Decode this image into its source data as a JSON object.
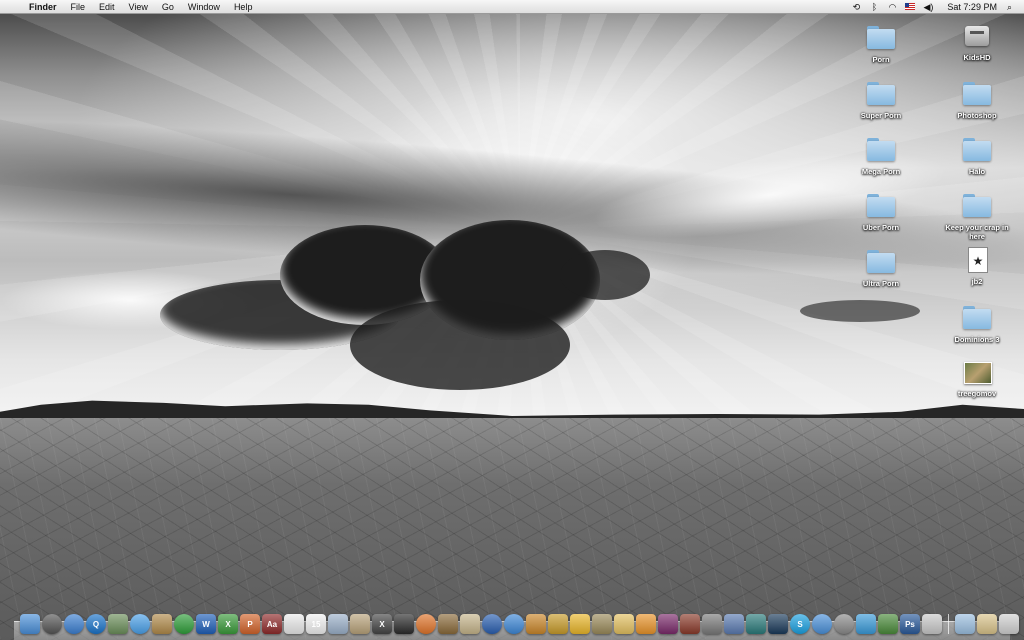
{
  "menubar": {
    "apple_icon": "apple-icon",
    "items": [
      "Finder",
      "File",
      "Edit",
      "View",
      "Go",
      "Window",
      "Help"
    ],
    "status_icons": [
      "time-machine-icon",
      "bluetooth-icon",
      "wifi-icon",
      "input-flag-icon",
      "volume-icon"
    ],
    "clock": "Sat 7:29 PM",
    "spotlight_icon": "spotlight-icon"
  },
  "desktop_icons": [
    {
      "label": "Porn",
      "type": "folder"
    },
    {
      "label": "KidsHD",
      "type": "drive"
    },
    {
      "label": "Super Porn",
      "type": "folder"
    },
    {
      "label": "Photoshop",
      "type": "folder"
    },
    {
      "label": "Mega Porn",
      "type": "folder"
    },
    {
      "label": "Halo",
      "type": "folder"
    },
    {
      "label": "Uber Porn",
      "type": "folder"
    },
    {
      "label": "Keep your crap in here",
      "type": "folder"
    },
    {
      "label": "Ultra Porn",
      "type": "folder"
    },
    {
      "label": "jb2",
      "type": "movie-doc"
    },
    {
      "label": "Dominions 3",
      "type": "folder"
    },
    {
      "label": "treegomov",
      "type": "thumb"
    }
  ],
  "dock": {
    "items": [
      {
        "icon": "finder-icon",
        "color": "#4a8fd8",
        "glyph": ""
      },
      {
        "icon": "dashboard-icon",
        "color": "#555555",
        "glyph": ""
      },
      {
        "icon": "safari-icon",
        "color": "#3b7fd1",
        "glyph": ""
      },
      {
        "icon": "quicktime-icon",
        "color": "#1a73c9",
        "glyph": "Q"
      },
      {
        "icon": "utility-icon",
        "color": "#6b8e5a",
        "glyph": ""
      },
      {
        "icon": "ichat-icon",
        "color": "#4aa0e8",
        "glyph": ""
      },
      {
        "icon": "address-book-icon",
        "color": "#b08a4a",
        "glyph": ""
      },
      {
        "icon": "green-app-icon",
        "color": "#2f9e3a",
        "glyph": ""
      },
      {
        "icon": "word-icon",
        "color": "#1f5fb8",
        "glyph": "W"
      },
      {
        "icon": "excel-icon",
        "color": "#3a9a3a",
        "glyph": "X"
      },
      {
        "icon": "powerpoint-icon",
        "color": "#d2632a",
        "glyph": "P"
      },
      {
        "icon": "dictionary-icon",
        "color": "#8e2a2a",
        "glyph": "Aa"
      },
      {
        "icon": "textedit-icon",
        "color": "#e9e9e9",
        "glyph": ""
      },
      {
        "icon": "ical-icon",
        "color": "#f0f0f0",
        "glyph": "15"
      },
      {
        "icon": "preview-icon",
        "color": "#9bb0c9",
        "glyph": ""
      },
      {
        "icon": "mail-icon",
        "color": "#b8a27a",
        "glyph": ""
      },
      {
        "icon": "x11-icon",
        "color": "#444444",
        "glyph": "X"
      },
      {
        "icon": "clapper-icon",
        "color": "#2b2b2b",
        "glyph": ""
      },
      {
        "icon": "firefox-icon",
        "color": "#e0742a",
        "glyph": ""
      },
      {
        "icon": "photo-icon",
        "color": "#8a6a3a",
        "glyph": ""
      },
      {
        "icon": "automator-icon",
        "color": "#c5b48a",
        "glyph": ""
      },
      {
        "icon": "network-icon",
        "color": "#2a5fb0",
        "glyph": ""
      },
      {
        "icon": "itunes-icon",
        "color": "#3d87d6",
        "glyph": ""
      },
      {
        "icon": "garageband-icon",
        "color": "#c9862a",
        "glyph": ""
      },
      {
        "icon": "feather-icon",
        "color": "#c79b2a",
        "glyph": ""
      },
      {
        "icon": "iphoto-icon",
        "color": "#e9b62a",
        "glyph": ""
      },
      {
        "icon": "city-icon",
        "color": "#9a8a5a",
        "glyph": ""
      },
      {
        "icon": "pizza-icon",
        "color": "#e3c060",
        "glyph": ""
      },
      {
        "icon": "orange-app-icon",
        "color": "#e8932a",
        "glyph": ""
      },
      {
        "icon": "game-icon",
        "color": "#7a2a6a",
        "glyph": ""
      },
      {
        "icon": "tea-icon",
        "color": "#8a3a2a",
        "glyph": ""
      },
      {
        "icon": "pen-icon",
        "color": "#7a7a7a",
        "glyph": ""
      },
      {
        "icon": "app-store-icon",
        "color": "#5a7ab0",
        "glyph": ""
      },
      {
        "icon": "terminal-icon",
        "color": "#2a7a7a",
        "glyph": ""
      },
      {
        "icon": "activity-icon",
        "color": "#1a3a5a",
        "glyph": ""
      },
      {
        "icon": "skype-icon",
        "color": "#1aa0e0",
        "glyph": "S"
      },
      {
        "icon": "globe-icon",
        "color": "#4a90d8",
        "glyph": ""
      },
      {
        "icon": "system-prefs-icon",
        "color": "#8a8a8a",
        "glyph": ""
      },
      {
        "icon": "butterfly-icon",
        "color": "#3a9ad8",
        "glyph": ""
      },
      {
        "icon": "flower-icon",
        "color": "#4a8a3a",
        "glyph": ""
      },
      {
        "icon": "photoshop-icon",
        "color": "#2a5a9a",
        "glyph": "Ps"
      },
      {
        "icon": "script-icon",
        "color": "#c8c8c8",
        "glyph": ""
      }
    ],
    "right_items": [
      {
        "icon": "applications-folder-icon",
        "color": "#9bbfe0"
      },
      {
        "icon": "downloads-stack-icon",
        "color": "#d9c38a"
      },
      {
        "icon": "trash-icon",
        "color": "#d0d0d0"
      }
    ]
  }
}
